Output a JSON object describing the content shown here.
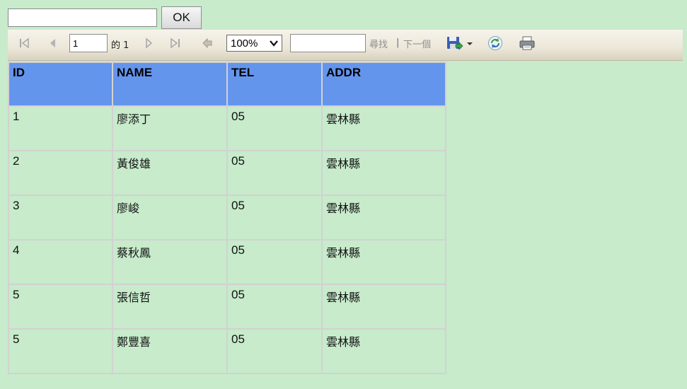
{
  "top": {
    "input_value": "",
    "ok_label": "OK"
  },
  "toolbar": {
    "first_page_icon": "first-page-icon",
    "prev_page_icon": "previous-page-icon",
    "current_page": "1",
    "of_text": "的 1",
    "next_page_icon": "next-page-icon",
    "last_page_icon": "last-page-icon",
    "back_icon": "back-icon",
    "zoom_value": "100%",
    "find_value": "",
    "find_label": "尋找",
    "separator": "|",
    "next_label": "下一個",
    "export_icon": "save-export-icon",
    "refresh_icon": "refresh-icon",
    "print_icon": "print-icon"
  },
  "table": {
    "headers": [
      "ID",
      "NAME",
      "TEL",
      "ADDR"
    ],
    "rows": [
      [
        "1",
        "廖添丁",
        "05",
        "雲林縣"
      ],
      [
        "2",
        "黃俊雄",
        "05",
        "雲林縣"
      ],
      [
        "3",
        "廖峻",
        "05",
        "雲林縣"
      ],
      [
        "4",
        "蔡秋鳳",
        "05",
        "雲林縣"
      ],
      [
        "5",
        "張信哲",
        "05",
        "雲林縣"
      ],
      [
        "5",
        "鄭豐喜",
        "05",
        "雲林縣"
      ]
    ]
  },
  "colors": {
    "page_background": "#c7ebcb",
    "header_background": "#6495ed",
    "toolbar_background": "#ece7d9"
  }
}
